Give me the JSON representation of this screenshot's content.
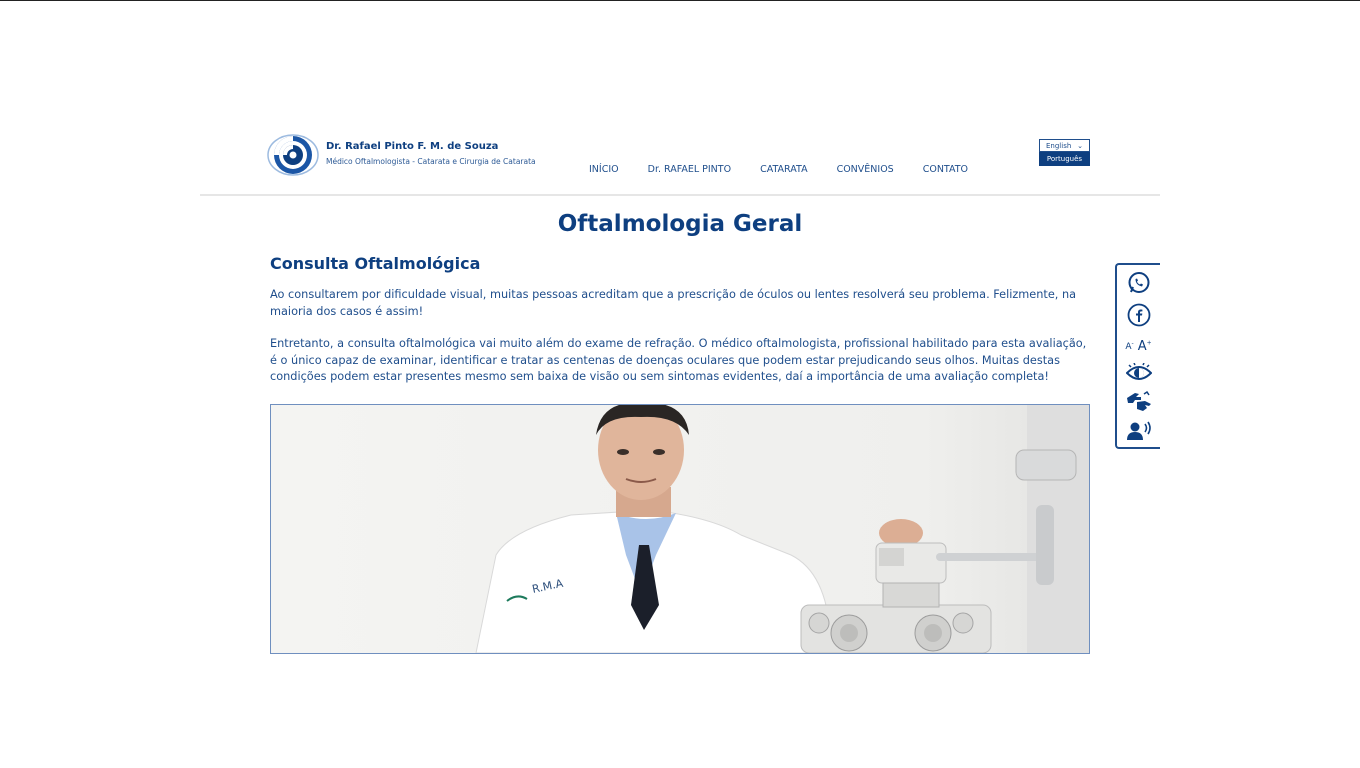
{
  "brand": {
    "name": "Dr. Rafael Pinto F. M. de Souza",
    "subtitle": "Médico Oftalmologista - Catarata e Cirurgia de Catarata"
  },
  "nav": [
    {
      "label": "INÍCIO"
    },
    {
      "label": "Dr. RAFAEL PINTO"
    },
    {
      "label": "CATARATA"
    },
    {
      "label": "CONVÊNIOS"
    },
    {
      "label": "CONTATO"
    }
  ],
  "language": {
    "current": "English",
    "options": [
      "Português"
    ]
  },
  "page": {
    "title": "Oftalmologia Geral",
    "section_title": "Consulta Oftalmológica",
    "paragraphs": [
      "Ao consultarem por dificuldade visual, muitas pessoas acreditam que a prescrição de óculos ou lentes resolverá seu problema. Felizmente, na maioria dos casos é assim!",
      "Entretanto, a consulta oftalmológica vai muito além do exame de refração. O médico oftalmologista, profissional habilitado para esta avaliação, é o único capaz de examinar, identificar e tratar as centenas de doenças oculares que podem estar prejudicando seus olhos. Muitas destas condições podem estar presentes mesmo sem baixa de visão ou sem sintomas evidentes, daí a importância de uma avaliação completa!"
    ]
  },
  "photo": {
    "coat_logo_text": "R.M.A"
  },
  "accessibility_bar": {
    "font_decrease_label": "A",
    "font_decrease_sup": "-",
    "font_increase_label": "A",
    "font_increase_sup": "+",
    "icons": [
      "whatsapp-icon",
      "facebook-icon",
      "font-size-icon",
      "high-contrast-icon",
      "sign-language-icon",
      "screen-reader-icon"
    ]
  },
  "colors": {
    "primary": "#0e3f80",
    "text": "#1f4e8c",
    "divider": "#e6e6e6"
  }
}
